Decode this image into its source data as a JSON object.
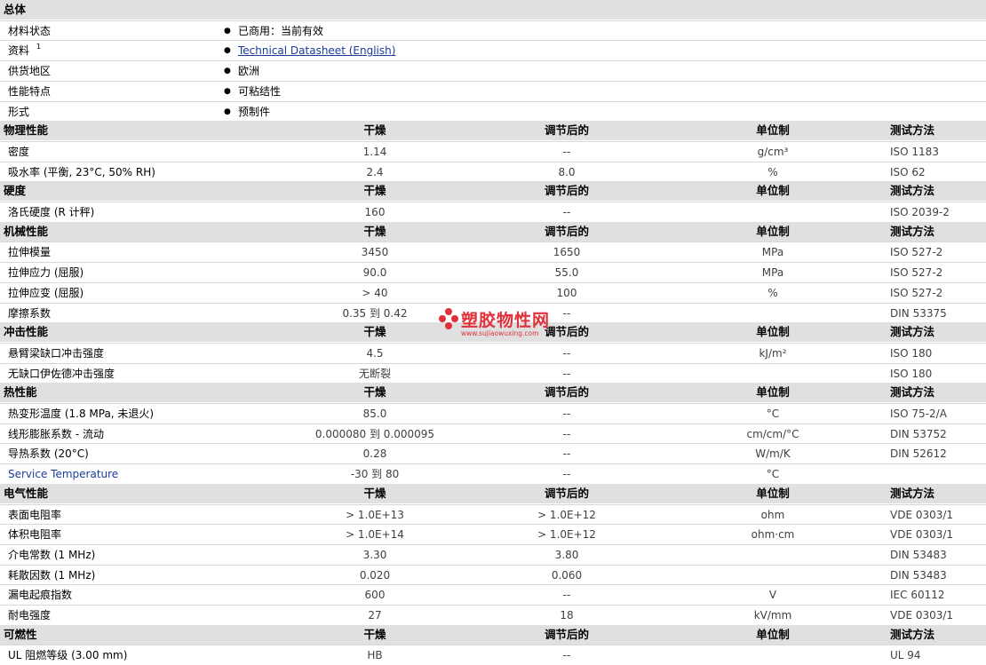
{
  "general": {
    "title": "总体",
    "items": [
      {
        "label": "材料状态",
        "value": "已商用：当前有效"
      },
      {
        "label": "资料",
        "sup": "1",
        "value": "Technical Datasheet (English)",
        "link": true
      },
      {
        "label": "供货地区",
        "value": "欧洲"
      },
      {
        "label": "性能特点",
        "value": "可粘结性"
      },
      {
        "label": "形式",
        "value": "预制件"
      }
    ]
  },
  "sections": [
    {
      "title": "物理性能",
      "dry": "干燥",
      "adj": "调节后的",
      "unit": "单位制",
      "test": "测试方法",
      "rows": [
        {
          "label": "密度",
          "dry": "1.14",
          "adj": "--",
          "unit": "g/cm³",
          "test": "ISO 1183"
        },
        {
          "label": "吸水率 (平衡, 23°C, 50% RH)",
          "dry": "2.4",
          "adj": "8.0",
          "unit": "%",
          "test": "ISO 62"
        }
      ]
    },
    {
      "title": "硬度",
      "dry": "干燥",
      "adj": "调节后的",
      "unit": "单位制",
      "test": "测试方法",
      "rows": [
        {
          "label": "洛氏硬度 (R 计秤)",
          "dry": "160",
          "adj": "--",
          "unit": "",
          "test": "ISO 2039-2"
        }
      ]
    },
    {
      "title": "机械性能",
      "dry": "干燥",
      "adj": "调节后的",
      "unit": "单位制",
      "test": "测试方法",
      "rows": [
        {
          "label": "拉伸模量",
          "dry": "3450",
          "adj": "1650",
          "unit": "MPa",
          "test": "ISO 527-2"
        },
        {
          "label": "拉伸应力 (屈服)",
          "dry": "90.0",
          "adj": "55.0",
          "unit": "MPa",
          "test": "ISO 527-2"
        },
        {
          "label": "拉伸应变 (屈服)",
          "dry": "> 40",
          "adj": "100",
          "unit": "%",
          "test": "ISO 527-2"
        },
        {
          "label": "摩擦系数",
          "dry": "0.35 到  0.42",
          "adj": "--",
          "unit": "",
          "test": "DIN 53375"
        }
      ]
    },
    {
      "title": "冲击性能",
      "dry": "干燥",
      "adj": "调节后的",
      "unit": "单位制",
      "test": "测试方法",
      "rows": [
        {
          "label": "悬臂梁缺口冲击强度",
          "dry": "4.5",
          "adj": "--",
          "unit": "kJ/m²",
          "test": "ISO 180"
        },
        {
          "label": "无缺口伊佐德冲击强度",
          "dry": "无断裂",
          "adj": "--",
          "unit": "",
          "test": "ISO 180"
        }
      ]
    },
    {
      "title": "热性能",
      "dry": "干燥",
      "adj": "调节后的",
      "unit": "单位制",
      "test": "测试方法",
      "rows": [
        {
          "label": "热变形温度 (1.8 MPa, 未退火)",
          "dry": "85.0",
          "adj": "--",
          "unit": "°C",
          "test": "ISO 75-2/A"
        },
        {
          "label": "线形膨胀系数  - 流动",
          "dry": "0.000080 到  0.000095",
          "adj": "--",
          "unit": "cm/cm/°C",
          "test": "DIN 53752"
        },
        {
          "label": "导热系数 (20°C)",
          "dry": "0.28",
          "adj": "--",
          "unit": "W/m/K",
          "test": "DIN 52612"
        },
        {
          "label": "Service Temperature",
          "dry": "-30 到  80",
          "adj": "--",
          "unit": "°C",
          "test": "",
          "blue": true
        }
      ]
    },
    {
      "title": "电气性能",
      "dry": "干燥",
      "adj": "调节后的",
      "unit": "单位制",
      "test": "测试方法",
      "rows": [
        {
          "label": "表面电阻率",
          "dry": "> 1.0E+13",
          "adj": "> 1.0E+12",
          "unit": "ohm",
          "test": "VDE 0303/1"
        },
        {
          "label": "体积电阻率",
          "dry": "> 1.0E+14",
          "adj": "> 1.0E+12",
          "unit": "ohm·cm",
          "test": "VDE 0303/1"
        },
        {
          "label": "介电常数 (1 MHz)",
          "dry": "3.30",
          "adj": "3.80",
          "unit": "",
          "test": "DIN 53483"
        },
        {
          "label": "耗散因数 (1 MHz)",
          "dry": "0.020",
          "adj": "0.060",
          "unit": "",
          "test": "DIN 53483"
        },
        {
          "label": "漏电起痕指数",
          "dry": "600",
          "adj": "--",
          "unit": "V",
          "test": "IEC 60112"
        },
        {
          "label": "耐电强度",
          "dry": "27",
          "adj": "18",
          "unit": "kV/mm",
          "test": "VDE 0303/1"
        }
      ]
    },
    {
      "title": "可燃性",
      "dry": "干燥",
      "adj": "调节后的",
      "unit": "单位制",
      "test": "测试方法",
      "rows": [
        {
          "label": "UL 阻燃等级 (3.00 mm)",
          "dry": "HB",
          "adj": "--",
          "unit": "",
          "test": "UL 94"
        }
      ]
    }
  ],
  "watermark": {
    "text": "塑胶物性网",
    "url": "www.sujiaowuxing.com",
    "color": "#e0303a"
  }
}
